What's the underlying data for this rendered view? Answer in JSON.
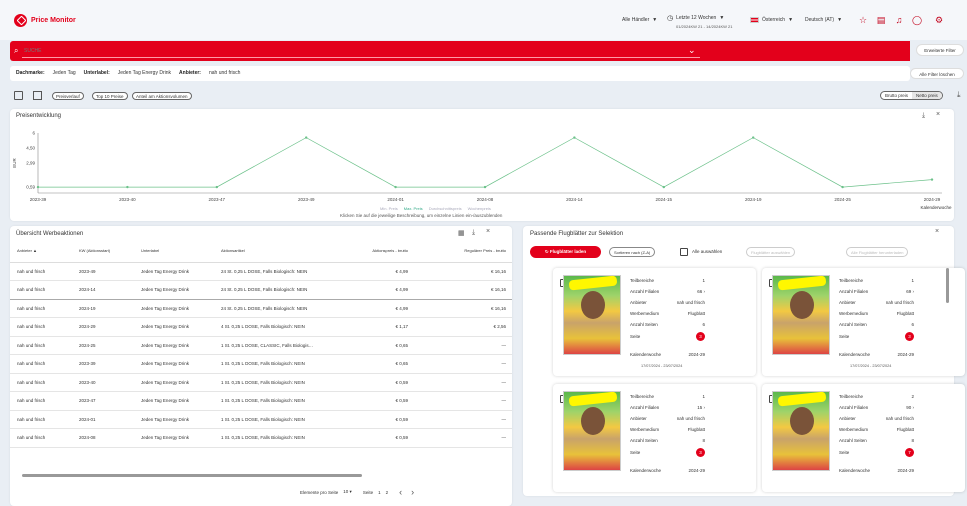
{
  "app": {
    "logo_text": "Price Monitor",
    "retailer_select": "Alle Händler",
    "period": "Letzte 12 Wochen",
    "period_range": "01/2024KW 21 - 14/2024KW 21",
    "country": "Österreich",
    "language": "Deutsch (AT)"
  },
  "search": {
    "placeholder": "SUCHE",
    "extended_label": "Erweiterte Filter"
  },
  "filters": {
    "items": [
      {
        "key": "Dachmarke:",
        "value": "Jeden Tag"
      },
      {
        "key": "Unterlabel:",
        "value": "Jeden Tag Energy Drink"
      },
      {
        "key": "Anbieter:",
        "value": "nah und frisch"
      }
    ],
    "clear_label": "Alle Filter löschen"
  },
  "toolbar": {
    "pills": [
      "Preisverlauf",
      "Top 10 Preise",
      "Anteil am Aktionsvolumen"
    ],
    "toggle": [
      "Brutto preis",
      "Netto preis"
    ]
  },
  "chart": {
    "title": "Preisentwicklung",
    "hint": "Klicken Sie auf die jeweilige Beschreibung, um einzelne Linien ein-/auszublenden",
    "legend": [
      "Min. Preis",
      "Max. Preis",
      "Durchschnittspreis",
      "Wochenpreis"
    ]
  },
  "chart_data": {
    "type": "line",
    "title": "Preisentwicklung",
    "xlabel": "Kalenderwoche",
    "ylabel": "EUR",
    "x": [
      "2023-39",
      "2023-40",
      "2023-47",
      "2023-49",
      "2024-01",
      "2024-08",
      "2024-14",
      "2024-15",
      "2024-19",
      "2024-25",
      "2024-29"
    ],
    "series": [
      {
        "name": "Max. Preis",
        "values": [
          0.59,
          0.59,
          0.59,
          5.54,
          0.59,
          0.59,
          5.54,
          0.59,
          5.54,
          0.59,
          1.34
        ]
      }
    ],
    "ylim": [
      0,
      6
    ],
    "yticks": [
      "6",
      "4,50",
      "2,99",
      "0,59"
    ],
    "legend": [
      "Min. Preis",
      "Max. Preis",
      "Durchschnittspreis",
      "Wochenpreis"
    ],
    "legend_position": "bottom",
    "grid": false,
    "line_color": "#6cc18a"
  },
  "table": {
    "title": "Übersicht Werbeaktionen",
    "columns": [
      "Anbieter",
      "KW (Aktionsstart)",
      "Unterlabel",
      "Aktionsartikel",
      "Aktionspreis - brutto",
      "Regulärer Preis - brutto"
    ],
    "rows": [
      [
        "nah und frisch",
        "2023-49",
        "Jeden Tag Energy Drink",
        "24 St. 0,25 L DOSE, Falls Biologisch: NEIN",
        "€ 4,99",
        "€ 16,16"
      ],
      [
        "nah und frisch",
        "2024-14",
        "Jeden Tag Energy Drink",
        "24 St. 0,25 L DOSE, Falls Biologisch: NEIN",
        "€ 4,99",
        "€ 16,16"
      ],
      [
        "nah und frisch",
        "2024-19",
        "Jeden Tag Energy Drink",
        "24 St. 0,25 L DOSE, Falls Biologisch: NEIN",
        "€ 4,99",
        "€ 16,16"
      ],
      [
        "nah und frisch",
        "2024-29",
        "Jeden Tag Energy Drink",
        "4 St. 0,25 L DOSE, Falls Biologisch: NEIN",
        "€ 1,17",
        "€ 2,56"
      ],
      [
        "nah und frisch",
        "2024-25",
        "Jeden Tag Energy Drink",
        "1 St. 0,25 L DOSE, CLASSIC, Falls Biologis…",
        "€ 0,65",
        "—"
      ],
      [
        "nah und frisch",
        "2023-39",
        "Jeden Tag Energy Drink",
        "1 St. 0,25 L DOSE, Falls Biologisch: NEIN",
        "€ 0,65",
        "—"
      ],
      [
        "nah und frisch",
        "2023-40",
        "Jeden Tag Energy Drink",
        "1 St. 0,25 L DOSE, Falls Biologisch: NEIN",
        "€ 0,59",
        "—"
      ],
      [
        "nah und frisch",
        "2023-47",
        "Jeden Tag Energy Drink",
        "1 St. 0,25 L DOSE, Falls Biologisch: NEIN",
        "€ 0,59",
        "—"
      ],
      [
        "nah und frisch",
        "2024-01",
        "Jeden Tag Energy Drink",
        "1 St. 0,25 L DOSE, Falls Biologisch: NEIN",
        "€ 0,59",
        "—"
      ],
      [
        "nah und frisch",
        "2024-08",
        "Jeden Tag Energy Drink",
        "1 St. 0,25 L DOSE, Falls Biologisch: NEIN",
        "€ 0,59",
        "—"
      ]
    ],
    "pager": {
      "per_page_label": "Elemente pro Seite",
      "per_page": "10",
      "page_label": "Seite",
      "page_current": "1",
      "page_total": "2"
    }
  },
  "flyers": {
    "title": "Passende Flugblätter zur Selektion",
    "load_label": "Flugblätter laden",
    "sort_label": "Sortieren nach (Z-A)",
    "select_all_label": "Alle auswählen",
    "disabled_select": "Flugblätter auswählen",
    "disabled_btn": "Alle Flugblätter herunterladen",
    "labels": {
      "sub": "Teilbereiche",
      "count": "Anzahl Filialen",
      "vendor": "Anbieter",
      "medium": "Werbemedium",
      "pages": "Anzahl Seiten",
      "page": "Seite",
      "week": "Kalenderwoche"
    },
    "cards": [
      {
        "sub": "1",
        "count": "66",
        "vendor": "nah und frisch",
        "medium": "Flugblatt",
        "pages": "6",
        "page": "3",
        "week": "2024-29",
        "range": "17/07/2024 - 23/07/2024"
      },
      {
        "sub": "1",
        "count": "69",
        "vendor": "nah und frisch",
        "medium": "Flugblatt",
        "pages": "6",
        "page": "3",
        "week": "2024-29",
        "range": "17/07/2024 - 23/07/2024"
      },
      {
        "sub": "1",
        "count": "15",
        "vendor": "nah und frisch",
        "medium": "Flugblatt",
        "pages": "8",
        "page": "3",
        "week": "2024-29",
        "range": ""
      },
      {
        "sub": "2",
        "count": "90",
        "vendor": "nah und frisch",
        "medium": "Flugblatt",
        "pages": "8",
        "page": "7",
        "week": "2024-29",
        "range": ""
      }
    ]
  }
}
